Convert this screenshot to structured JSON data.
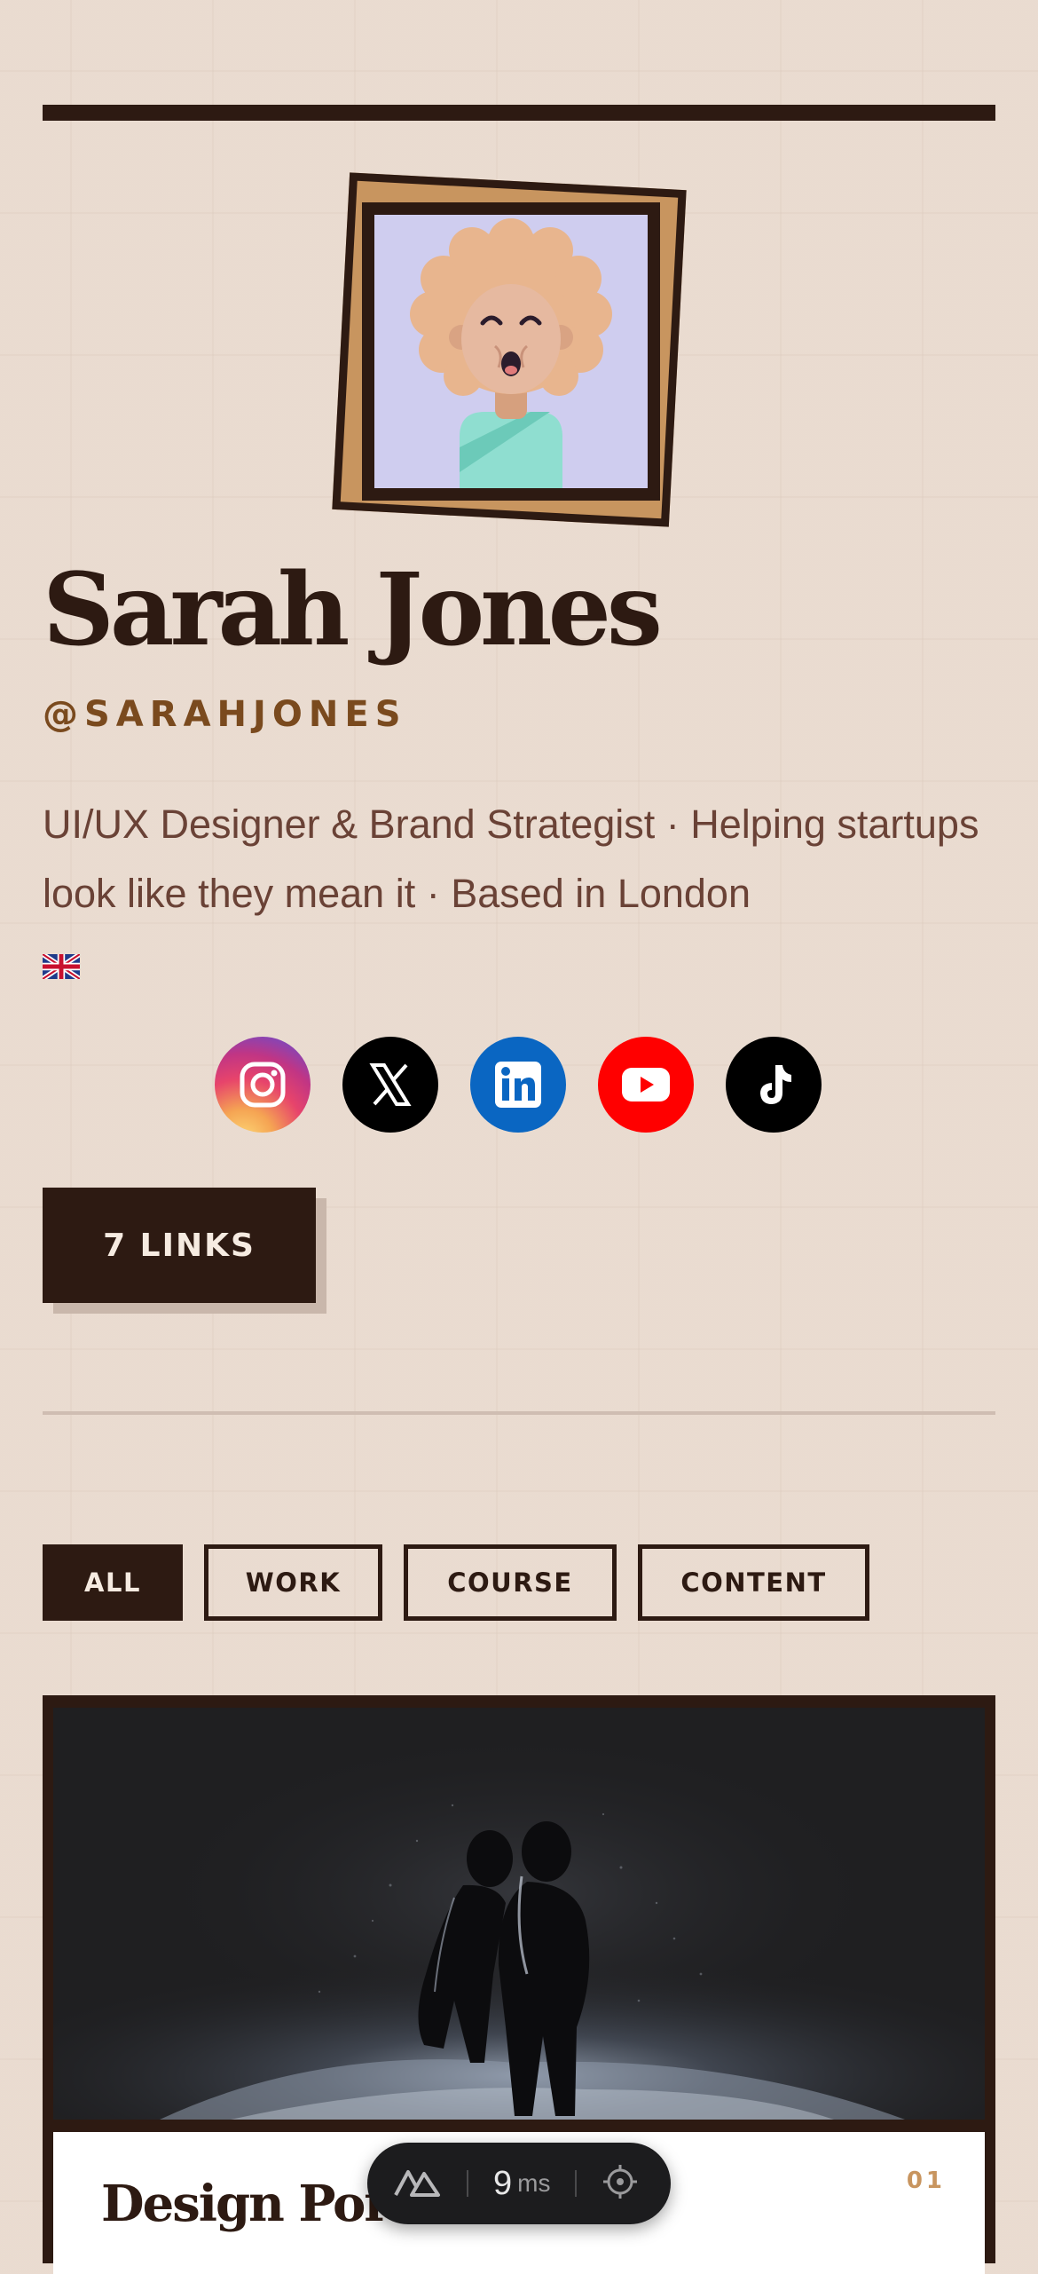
{
  "profile": {
    "name": "Sarah Jones",
    "handle": "@SARAHJONES",
    "bio": "UI/UX Designer & Brand Strategist · Helping startups look like they mean it · Based in London",
    "flag_icon": "uk-flag-icon"
  },
  "socials": [
    {
      "name": "instagram",
      "icon": "instagram-icon"
    },
    {
      "name": "x",
      "icon": "x-icon"
    },
    {
      "name": "linkedin",
      "icon": "linkedin-icon"
    },
    {
      "name": "youtube",
      "icon": "youtube-icon"
    },
    {
      "name": "tiktok",
      "icon": "tiktok-icon"
    }
  ],
  "links_button": {
    "label": "7 LINKS"
  },
  "filters": [
    {
      "label": "ALL",
      "active": true
    },
    {
      "label": "WORK",
      "active": false
    },
    {
      "label": "COURSE",
      "active": false
    },
    {
      "label": "CONTENT",
      "active": false
    }
  ],
  "cards": [
    {
      "title": "Design Portfolio",
      "number": "01"
    }
  ],
  "devtool": {
    "value": "9",
    "unit": "ms"
  },
  "colors": {
    "background": "#f6ebe1",
    "ink": "#2d1a12",
    "accent": "#c8955f",
    "handle": "#7a4a1e",
    "bio_text": "#6a4236"
  }
}
